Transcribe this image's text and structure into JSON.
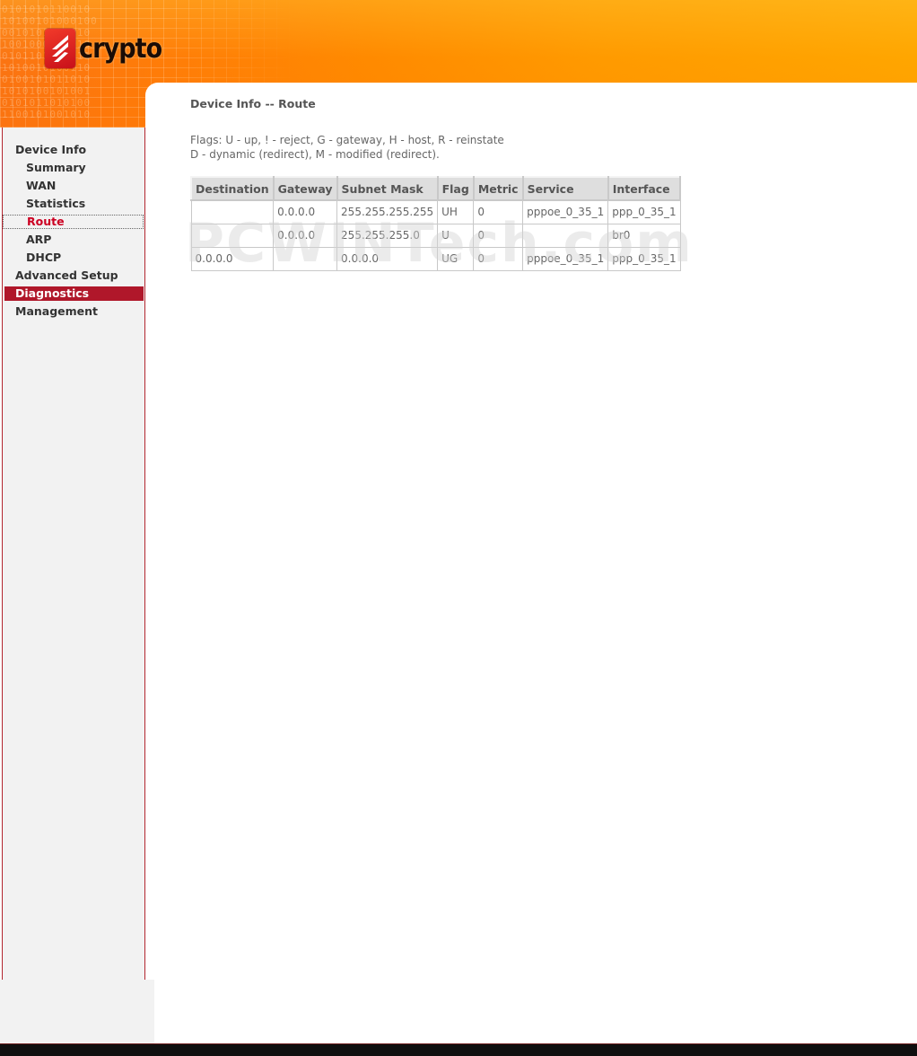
{
  "brand": {
    "name": "crypto"
  },
  "nav": {
    "items": [
      {
        "label": "Device Info",
        "name": "nav-device-info",
        "level": 0,
        "state": "normal"
      },
      {
        "label": "Summary",
        "name": "nav-summary",
        "level": 1,
        "state": "normal"
      },
      {
        "label": "WAN",
        "name": "nav-wan",
        "level": 1,
        "state": "normal"
      },
      {
        "label": "Statistics",
        "name": "nav-statistics",
        "level": 1,
        "state": "normal"
      },
      {
        "label": "Route",
        "name": "nav-route",
        "level": 1,
        "state": "active"
      },
      {
        "label": "ARP",
        "name": "nav-arp",
        "level": 1,
        "state": "normal"
      },
      {
        "label": "DHCP",
        "name": "nav-dhcp",
        "level": 1,
        "state": "normal"
      },
      {
        "label": "Advanced Setup",
        "name": "nav-advanced-setup",
        "level": 0,
        "state": "normal"
      },
      {
        "label": "Diagnostics",
        "name": "nav-diagnostics",
        "level": 0,
        "state": "highlight"
      },
      {
        "label": "Management",
        "name": "nav-management",
        "level": 0,
        "state": "normal"
      }
    ]
  },
  "main": {
    "title": "Device Info -- Route",
    "flags_line1": "Flags: U - up, ! - reject, G - gateway, H - host, R - reinstate",
    "flags_line2": "D - dynamic (redirect), M - modified (redirect).",
    "table": {
      "columns": [
        "Destination",
        "Gateway",
        "Subnet Mask",
        "Flag",
        "Metric",
        "Service",
        "Interface"
      ],
      "rows": [
        [
          "",
          "0.0.0.0",
          "255.255.255.255",
          "UH",
          "0",
          "pppoe_0_35_1",
          "ppp_0_35_1"
        ],
        [
          "",
          "0.0.0.0",
          "255.255.255.0",
          "U",
          "0",
          "",
          "br0"
        ],
        [
          "0.0.0.0",
          "",
          "0.0.0.0",
          "UG",
          "0",
          "pppoe_0_35_1",
          "ppp_0_35_1"
        ]
      ]
    }
  },
  "watermark": {
    "text": "PCWINTech.com"
  },
  "colors": {
    "header_orange": "#ff8a00",
    "nav_active_text": "#cc0022",
    "nav_highlight_bg": "#b0172a",
    "sidebar_border": "#b3262f",
    "table_header_bg": "#dedede"
  }
}
